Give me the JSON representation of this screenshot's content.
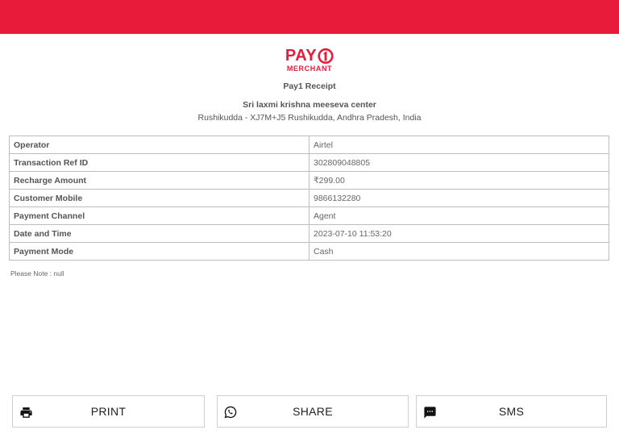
{
  "brand": {
    "logo_text": "PAY",
    "logo_sub": "MERCHANT",
    "color": "#e91b3a"
  },
  "receipt": {
    "title": "Pay1 Receipt",
    "shop_name": "Sri laxmi krishna meeseva center",
    "shop_address": "Rushikudda  - XJ7M+J5 Rushikudda, Andhra Pradesh, India",
    "rows": [
      {
        "label": "Operator",
        "value": "Airtel"
      },
      {
        "label": "Transaction Ref ID",
        "value": "302809048805"
      },
      {
        "label": "Recharge Amount",
        "value": "₹299.00"
      },
      {
        "label": "Customer Mobile",
        "value": "9866132280"
      },
      {
        "label": "Payment Channel",
        "value": "Agent"
      },
      {
        "label": "Date and Time",
        "value": "2023-07-10 11:53:20"
      },
      {
        "label": "Payment Mode",
        "value": "Cash"
      }
    ],
    "note": "Please Note : null"
  },
  "actions": {
    "print_label": "PRINT",
    "share_label": "SHARE",
    "sms_label": "SMS"
  },
  "icons": {
    "print": "printer-icon",
    "share": "whatsapp-icon",
    "sms": "message-icon"
  }
}
